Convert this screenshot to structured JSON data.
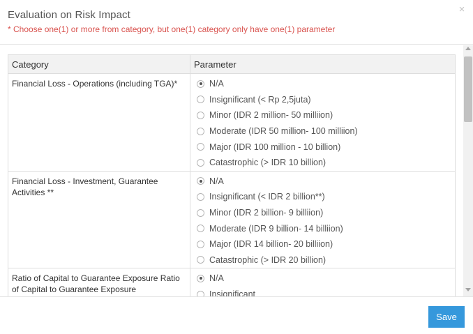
{
  "modal": {
    "title": "Evaluation on Risk Impact",
    "subtitle": "* Choose one(1) or more from category, but one(1) category only have one(1) parameter",
    "close_label": "×"
  },
  "table": {
    "headers": [
      "Category",
      "Parameter"
    ],
    "rows": [
      {
        "category": "Financial Loss - Operations (including TGA)*",
        "options": [
          "N/A",
          "Insignificant (< Rp 2,5juta)",
          "Minor (IDR 2 million- 50 milliion)",
          "Moderate (IDR 50 million- 100 milliion)",
          "Major (IDR 100 million - 10 billion)",
          "Catastrophic (> IDR 10 billion)"
        ],
        "selected": 0
      },
      {
        "category": "Financial Loss - Investment, Guarantee Activities **",
        "options": [
          "N/A",
          "Insignificant (< IDR 2 billion**)",
          "Minor (IDR 2 billion- 9 billiion)",
          "Moderate (IDR 9 billion- 14 billiion)",
          "Major (IDR 14 billion- 20 billiion)",
          "Catastrophic (> IDR 20 billion)"
        ],
        "selected": 0
      },
      {
        "category": "Ratio of Capital to Guarantee Exposure Ratio of Capital to Guarantee Exposure",
        "options": [
          "N/A",
          "Insignificant"
        ],
        "selected": 0
      }
    ]
  },
  "footer": {
    "save_label": "Save"
  },
  "colors": {
    "primary": "#3598dc",
    "warning_text": "#d9534f",
    "header_bg": "#f2f2f2"
  }
}
